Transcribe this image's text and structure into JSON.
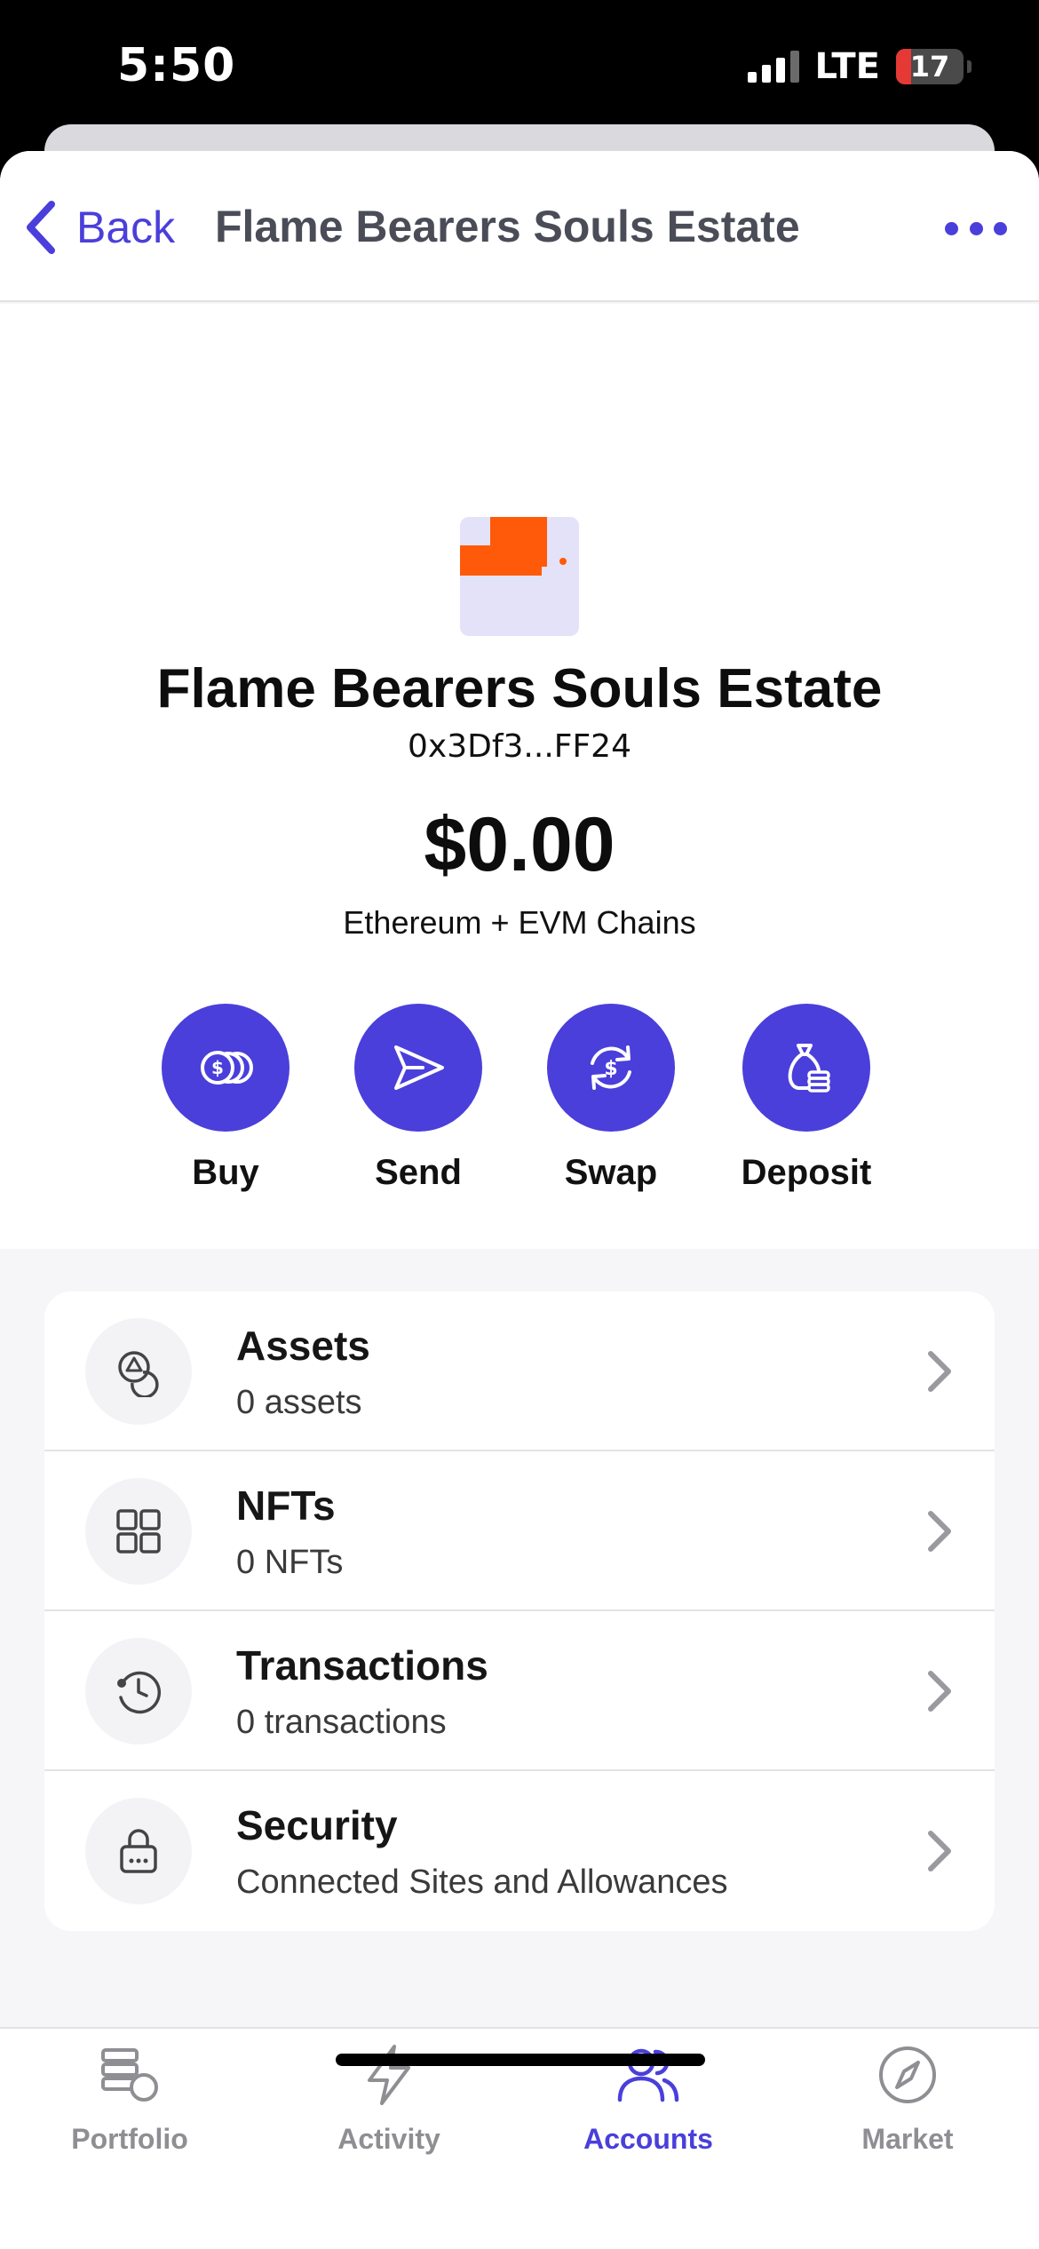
{
  "status_bar": {
    "time": "5:50",
    "network": "LTE",
    "battery": "17"
  },
  "header": {
    "back_label": "Back",
    "title": "Flame Bearers Souls Estate"
  },
  "account": {
    "name": "Flame Bearers Souls Estate",
    "address": "0x3Df3...FF24",
    "balance": "$0.00",
    "chains": "Ethereum + EVM Chains"
  },
  "actions": [
    {
      "label": "Buy",
      "icon": "coins-icon"
    },
    {
      "label": "Send",
      "icon": "send-icon"
    },
    {
      "label": "Swap",
      "icon": "swap-icon"
    },
    {
      "label": "Deposit",
      "icon": "deposit-icon"
    }
  ],
  "list": [
    {
      "title": "Assets",
      "subtitle": "0 assets",
      "icon": "assets-icon"
    },
    {
      "title": "NFTs",
      "subtitle": "0 NFTs",
      "icon": "grid-icon"
    },
    {
      "title": "Transactions",
      "subtitle": "0 transactions",
      "icon": "history-icon"
    },
    {
      "title": "Security",
      "subtitle": "Connected Sites and Allowances",
      "icon": "lock-icon"
    }
  ],
  "tabs": [
    {
      "label": "Portfolio",
      "icon": "portfolio-icon",
      "active": false
    },
    {
      "label": "Activity",
      "icon": "lightning-icon",
      "active": false
    },
    {
      "label": "Accounts",
      "icon": "users-icon",
      "active": true
    },
    {
      "label": "Market",
      "icon": "compass-icon",
      "active": false
    }
  ],
  "colors": {
    "accent": "#4a3fdb",
    "avatar_orange": "#ff5a0a",
    "avatar_bg": "#e4e2f8",
    "inactive_tab": "#8e8e93"
  }
}
